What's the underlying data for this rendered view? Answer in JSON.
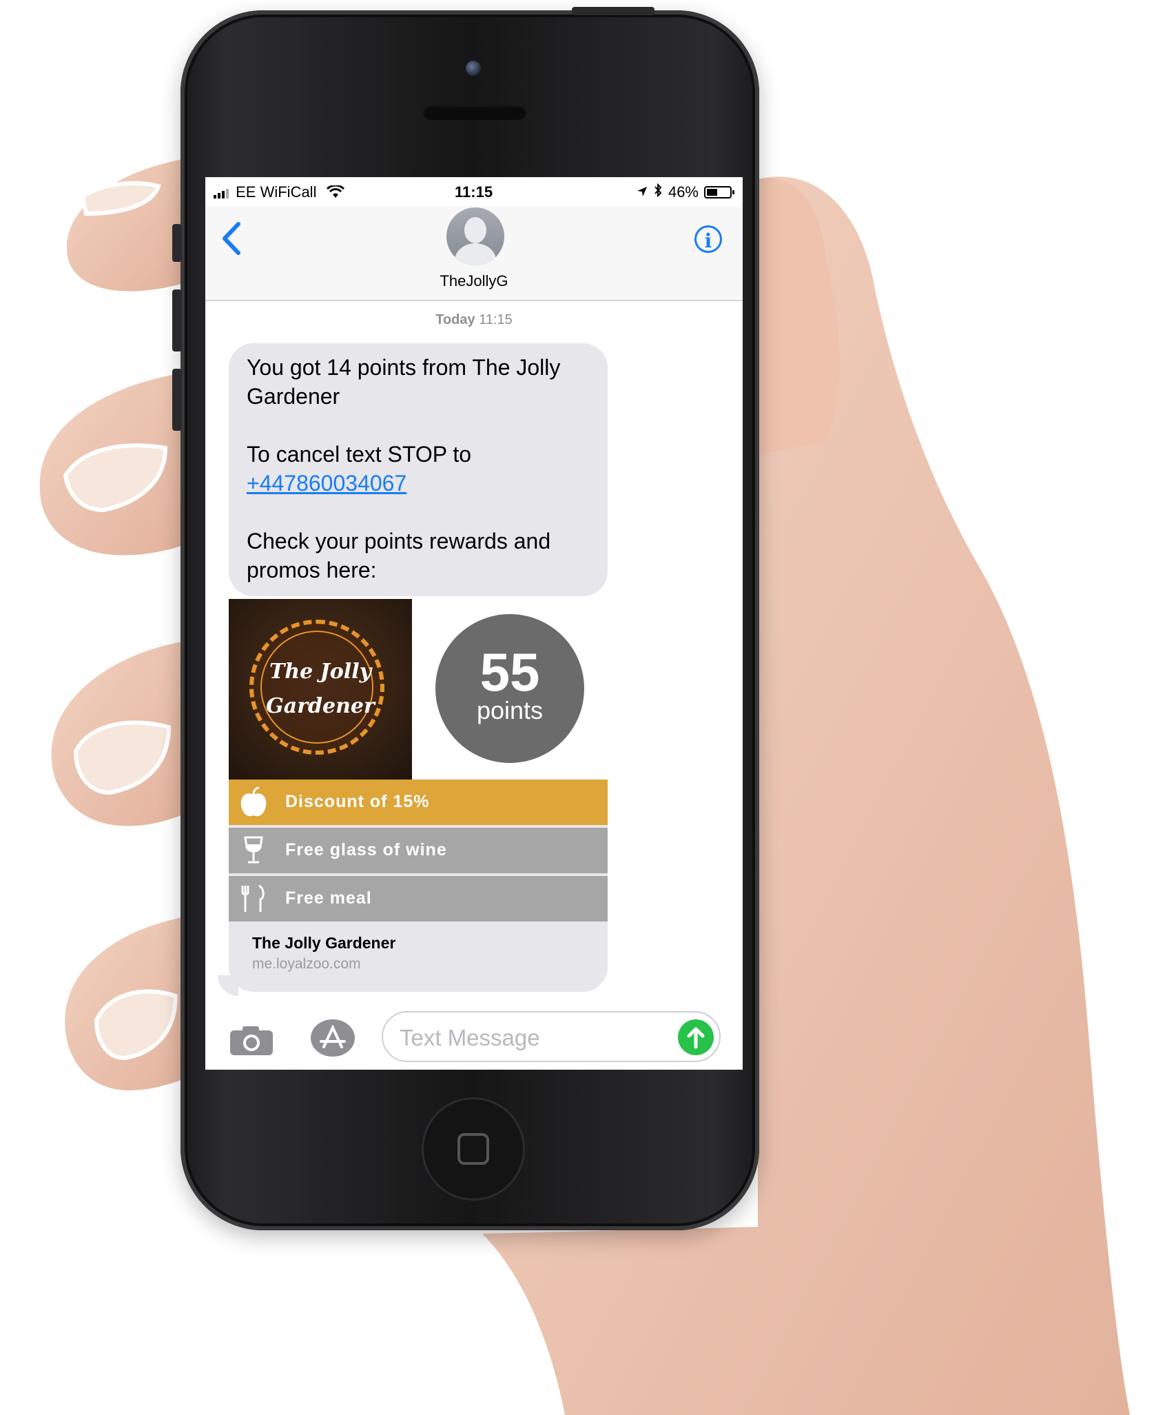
{
  "status_bar": {
    "carrier": "EE WiFiCall",
    "time": "11:15",
    "battery": "46%",
    "battery_level": 0.46
  },
  "header": {
    "back_icon": "chevron-left-icon",
    "contact_name": "TheJollyG",
    "info_icon": "info-icon"
  },
  "thread": {
    "timestamp_day": "Today",
    "timestamp_time": "11:15",
    "message": {
      "line1": "You got 14 points from The Jolly Gardener",
      "line2_prefix": "To cancel text STOP to",
      "phone_link": "+447860034067",
      "line3": "Check your points rewards and promos here:"
    },
    "link_preview": {
      "logo_line1": "The Jolly",
      "logo_line2": "Gardener",
      "points_value": "55",
      "points_label": "points",
      "rewards": [
        {
          "label": "Discount of 15%",
          "icon": "apple-icon",
          "color": "#dea539"
        },
        {
          "label": "Free glass of wine",
          "icon": "wine-glass-icon",
          "color": "#a6a6a6"
        },
        {
          "label": "Free meal",
          "icon": "fork-knife-icon",
          "color": "#a6a6a6"
        }
      ],
      "title": "The Jolly Gardener",
      "url": "me.loyalzoo.com"
    }
  },
  "compose": {
    "camera_icon": "camera-icon",
    "apps_icon": "app-store-icon",
    "placeholder": "Text Message",
    "send_icon": "send-arrow-icon"
  },
  "colors": {
    "ios_blue": "#1a7cf5",
    "bubble_gray": "#e6e6eb",
    "reward_gold": "#dea539",
    "reward_gray": "#a6a6a6",
    "send_green": "#28c14a"
  }
}
